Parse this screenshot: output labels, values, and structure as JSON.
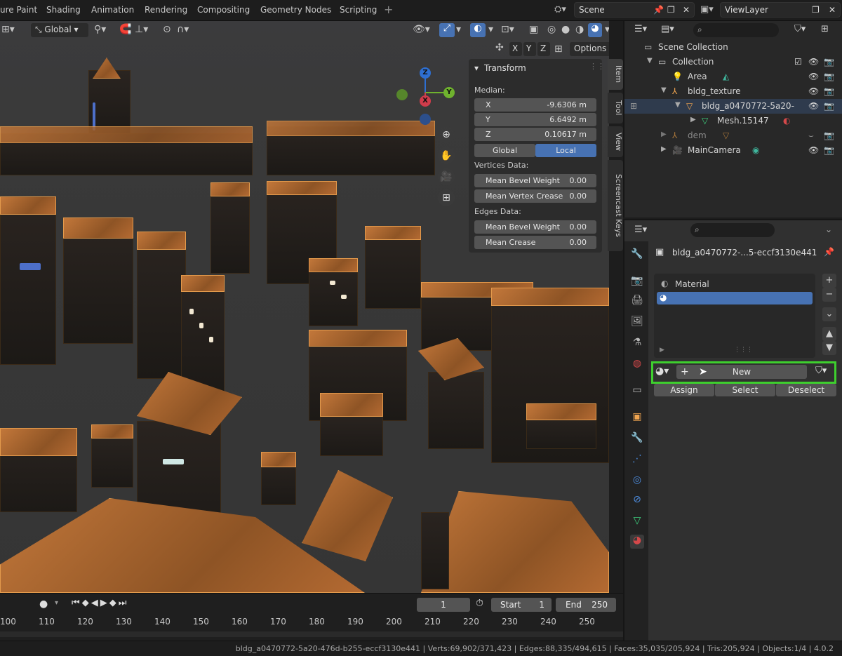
{
  "workspace_tabs": [
    "ure Paint",
    "Shading",
    "Animation",
    "Rendering",
    "Compositing",
    "Geometry Nodes",
    "Scripting"
  ],
  "scene": {
    "label": "Scene",
    "view_layer": "ViewLayer"
  },
  "viewport": {
    "orientation": "Global",
    "axis_x": "X",
    "axis_y": "Y",
    "axis_z": "Z",
    "options": "Options"
  },
  "gizmo": {
    "x": "X",
    "y": "Y",
    "z": "Z"
  },
  "npanel": {
    "title": "Transform",
    "median": "Median:",
    "x_label": "X",
    "x_value": "-9.6306 m",
    "y_label": "Y",
    "y_value": "6.6492 m",
    "z_label": "Z",
    "z_value": "0.10617 m",
    "global": "Global",
    "local": "Local",
    "vertices_data": "Vertices Data:",
    "mean_bevel_weight_v": "Mean Bevel Weight",
    "mean_bevel_weight_v_value": "0.00",
    "mean_vertex_crease": "Mean Vertex Crease",
    "mean_vertex_crease_value": "0.00",
    "edges_data": "Edges Data:",
    "mean_bevel_weight_e": "Mean Bevel Weight",
    "mean_bevel_weight_e_value": "0.00",
    "mean_crease": "Mean Crease",
    "mean_crease_value": "0.00",
    "tabs": [
      "Item",
      "Tool",
      "View",
      "Screencast Keys"
    ]
  },
  "timeline": {
    "current_frame": "1",
    "start_label": "Start",
    "start": "1",
    "end_label": "End",
    "end": "250",
    "ruler": [
      "100",
      "110",
      "120",
      "130",
      "140",
      "150",
      "160",
      "170",
      "180",
      "190",
      "200",
      "210",
      "220",
      "230",
      "240",
      "250"
    ]
  },
  "status_bar": "bldg_a0470772-5a20-476d-b255-eccf3130e441 | Verts:69,902/371,423 | Edges:88,335/494,615 | Faces:35,035/205,924 | Tris:205,924 | Objects:1/4 | 4.0.2",
  "outliner": {
    "scene_collection": "Scene Collection",
    "collection": "Collection",
    "area": "Area",
    "bldg_texture": "bldg_texture",
    "bldg_obj": "bldg_a0470772-5a20-",
    "mesh": "Mesh.15147",
    "dem": "dem",
    "camera": "MainCamera"
  },
  "properties": {
    "object_name": "bldg_a0470772-...5-eccf3130e441",
    "material_slot": "Material",
    "new_button": "New",
    "assign": "Assign",
    "select": "Select",
    "deselect": "Deselect"
  },
  "colors": {
    "accent_blue": "#4772b3",
    "highlight_green": "#3ecf2e",
    "roof_orange": "#c2773a"
  }
}
